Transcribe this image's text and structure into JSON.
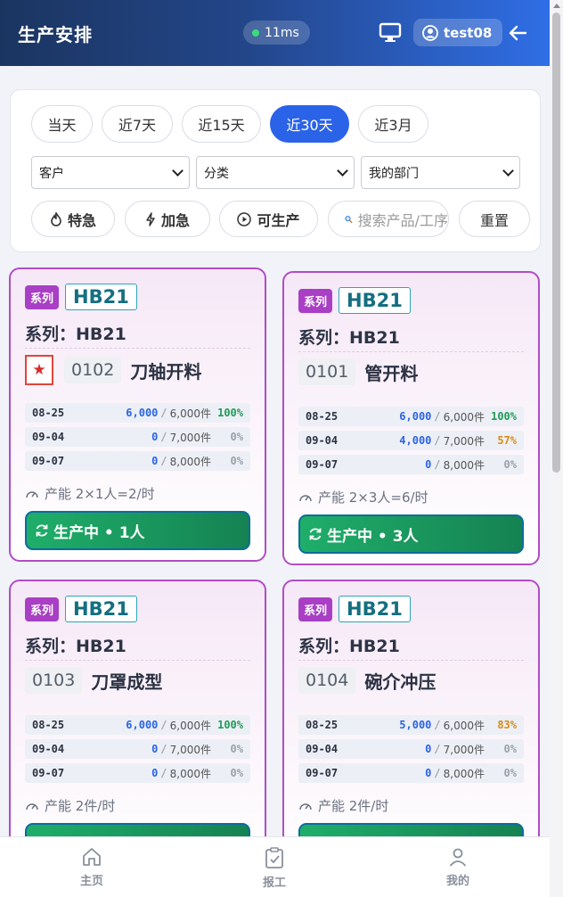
{
  "header": {
    "title": "生产安排",
    "latency": "11ms",
    "username": "test08"
  },
  "filters": {
    "ranges": [
      "当天",
      "近7天",
      "近15天",
      "近30天",
      "近3月"
    ],
    "active_range": "近30天",
    "selects": {
      "customer": "客户",
      "category": "分类",
      "department": "我的部门"
    },
    "buttons": {
      "urgent_special": "特急",
      "urgent": "加急",
      "producible": "可生产",
      "reset": "重置"
    },
    "search_placeholder": "搜索产品/工序"
  },
  "cards": [
    {
      "series_tag": "系列",
      "code": "HB21",
      "series_line": "系列：HB21",
      "op_code": "0102",
      "op_name": "刀轴开料",
      "starred": true,
      "rows": [
        {
          "date": "08-25",
          "done": "6,000",
          "plan": "6,000件",
          "pct": "100%"
        },
        {
          "date": "09-04",
          "done": "0",
          "plan": "7,000件",
          "pct": "0%"
        },
        {
          "date": "09-07",
          "done": "0",
          "plan": "8,000件",
          "pct": "0%"
        }
      ],
      "capacity": "产能 2×1人=2/时",
      "status": "生产中 • 1人"
    },
    {
      "series_tag": "系列",
      "code": "HB21",
      "series_line": "系列：HB21",
      "op_code": "0101",
      "op_name": "管开料",
      "starred": false,
      "rows": [
        {
          "date": "08-25",
          "done": "6,000",
          "plan": "6,000件",
          "pct": "100%"
        },
        {
          "date": "09-04",
          "done": "4,000",
          "plan": "7,000件",
          "pct": "57%"
        },
        {
          "date": "09-07",
          "done": "0",
          "plan": "8,000件",
          "pct": "0%"
        }
      ],
      "capacity": "产能 2×3人=6/时",
      "status": "生产中 • 3人"
    },
    {
      "series_tag": "系列",
      "code": "HB21",
      "series_line": "系列：HB21",
      "op_code": "0103",
      "op_name": "刀罩成型",
      "starred": false,
      "rows": [
        {
          "date": "08-25",
          "done": "6,000",
          "plan": "6,000件",
          "pct": "100%"
        },
        {
          "date": "09-04",
          "done": "0",
          "plan": "7,000件",
          "pct": "0%"
        },
        {
          "date": "09-07",
          "done": "0",
          "plan": "8,000件",
          "pct": "0%"
        }
      ],
      "capacity": "产能 2件/时",
      "status": ""
    },
    {
      "series_tag": "系列",
      "code": "HB21",
      "series_line": "系列：HB21",
      "op_code": "0104",
      "op_name": "碗介冲压",
      "starred": false,
      "rows": [
        {
          "date": "08-25",
          "done": "5,000",
          "plan": "6,000件",
          "pct": "83%"
        },
        {
          "date": "09-04",
          "done": "0",
          "plan": "7,000件",
          "pct": "0%"
        },
        {
          "date": "09-07",
          "done": "0",
          "plan": "8,000件",
          "pct": "0%"
        }
      ],
      "capacity": "产能 2件/时",
      "status": ""
    }
  ],
  "nav": {
    "home": "主页",
    "report": "报工",
    "mine": "我的"
  }
}
